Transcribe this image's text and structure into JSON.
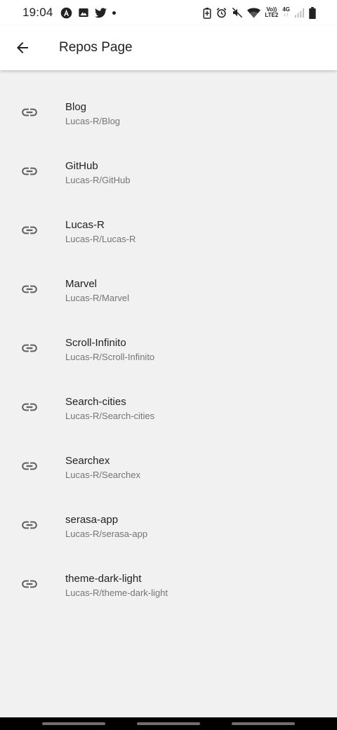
{
  "status_bar": {
    "time": "19:04",
    "volte_line1": "Vo))",
    "volte_line2": "LTE2",
    "network": "4G",
    "icons": [
      "angular-icon",
      "image-icon",
      "twitter-icon",
      "notification-dot-icon",
      "battery-saver-icon",
      "alarm-icon",
      "mute-icon",
      "wifi-icon",
      "signal-icon",
      "battery-icon"
    ]
  },
  "app_bar": {
    "title": "Repos Page",
    "back_icon": "arrow-back-icon"
  },
  "repos": [
    {
      "name": "Blog",
      "path": "Lucas-R/Blog"
    },
    {
      "name": "GitHub",
      "path": "Lucas-R/GitHub"
    },
    {
      "name": "Lucas-R",
      "path": "Lucas-R/Lucas-R"
    },
    {
      "name": "Marvel",
      "path": "Lucas-R/Marvel"
    },
    {
      "name": "Scroll-Infinito",
      "path": "Lucas-R/Scroll-Infinito"
    },
    {
      "name": "Search-cities",
      "path": "Lucas-R/Search-cities"
    },
    {
      "name": "Searchex",
      "path": "Lucas-R/Searchex"
    },
    {
      "name": "serasa-app",
      "path": "Lucas-R/serasa-app"
    },
    {
      "name": "theme-dark-light",
      "path": "Lucas-R/theme-dark-light"
    }
  ],
  "colors": {
    "background": "#f1f1f1",
    "app_bar": "#ffffff",
    "primary_text": "#222222",
    "secondary_text": "#757575",
    "icon": "#616161"
  }
}
